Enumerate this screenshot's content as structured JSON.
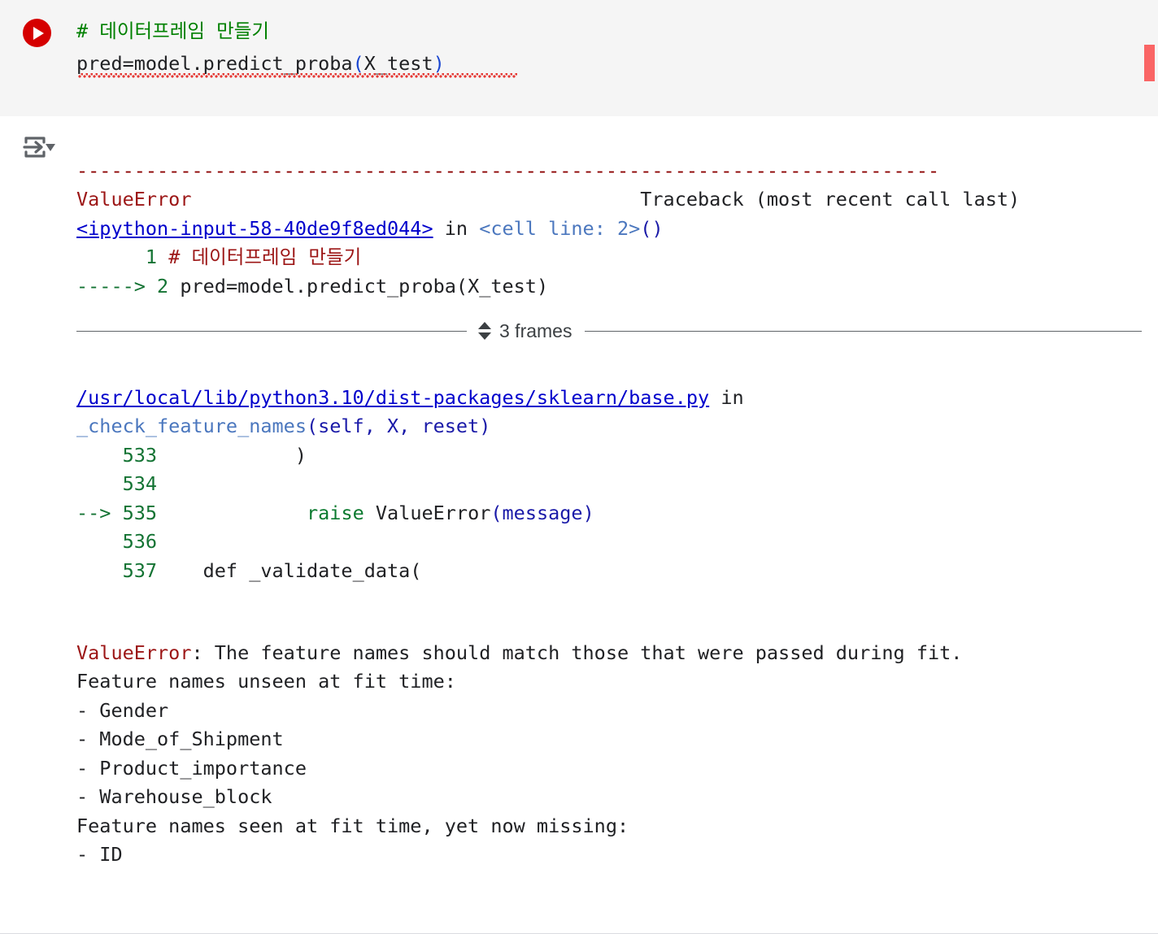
{
  "cell": {
    "run_button": "run-cell",
    "code_lines": [
      {
        "segments": [
          {
            "text": "# 데이터프레임 만들기",
            "style": "comment"
          }
        ]
      },
      {
        "segments": [
          {
            "text": "pred=model.predict_proba",
            "style": "plain"
          },
          {
            "text": "(",
            "style": "paren"
          },
          {
            "text": "X_test",
            "style": "plain"
          },
          {
            "text": ")",
            "style": "paren"
          }
        ]
      }
    ],
    "code_line1": "# 데이터프레임 만들기",
    "code_line2": "pred=model.predict_proba(X_test)"
  },
  "output": {
    "toggle_icon": "output-options-icon",
    "error_marker_color": "#fa6565",
    "dashes": "---------------------------------------------------------------------------",
    "header": {
      "error_type": "ValueError",
      "traceback_label": "Traceback (most recent call last)"
    },
    "frame_cell": {
      "link": "<ipython-input-58-40de9f8ed044>",
      "in_word": "in",
      "location": "<cell line: 2>",
      "parens": "()",
      "lines": [
        {
          "marker": "",
          "number": "1",
          "code": "# 데이터프레임 만들기"
        },
        {
          "marker": "----->",
          "number": "2",
          "code": "pred=model.predict_proba(X_test)"
        }
      ]
    },
    "frames_toggle": {
      "label": "3 frames",
      "icon": "unfold-more-icon"
    },
    "frame_lib": {
      "path": "/usr/local/lib/python3.10/dist-packages/sklearn/base.py",
      "in_word": "in",
      "function": "_check_feature_names",
      "signature": "(self, X, reset)",
      "lines": [
        {
          "marker": "",
          "number": "533",
          "code": "            )"
        },
        {
          "marker": "",
          "number": "534",
          "code": ""
        },
        {
          "marker": "-->",
          "number": "535",
          "code": "            raise ValueError(message)"
        },
        {
          "marker": "",
          "number": "536",
          "code": ""
        },
        {
          "marker": "",
          "number": "537",
          "code": "    def _validate_data("
        }
      ]
    },
    "message": {
      "error_type": "ValueError",
      "separator": ": ",
      "summary": "The feature names should match those that were passed during fit.",
      "unseen_header": "Feature names unseen at fit time:",
      "unseen": [
        "- Gender",
        "- Mode_of_Shipment",
        "- Product_importance",
        "- Warehouse_block"
      ],
      "missing_header": "Feature names seen at fit time, yet now missing:",
      "missing": [
        "- ID"
      ]
    }
  },
  "colors": {
    "cell_background": "#f5f5f5",
    "run_button": "#d50000",
    "error_red": "#9c1616",
    "dash_red": "#8b0000",
    "link_blue": "#0000cc",
    "steel_blue": "#4b77be",
    "green": "#137333",
    "marker_red": "#fa6565"
  }
}
